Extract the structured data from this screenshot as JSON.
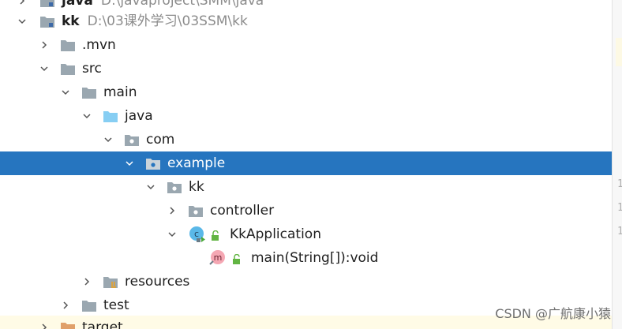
{
  "tree": {
    "top_partial": {
      "name": "java",
      "path": "D:\\javaproject\\SMM\\java"
    },
    "rows": [
      {
        "name": "kk",
        "path": "D:\\03课外学习\\03SSM\\kk"
      },
      {
        "name": ".mvn"
      },
      {
        "name": "src"
      },
      {
        "name": "main"
      },
      {
        "name": "java"
      },
      {
        "name": "com"
      },
      {
        "name": "example"
      },
      {
        "name": "kk"
      },
      {
        "name": "controller"
      },
      {
        "name": "KkApplication",
        "icon_letter": "c"
      },
      {
        "name": "main(String[]):void",
        "icon_letter": "m"
      },
      {
        "name": "resources"
      },
      {
        "name": "test"
      },
      {
        "name": "target"
      }
    ]
  },
  "colors": {
    "selection": "#2675bf",
    "folder_gray": "#9aa7b0",
    "source_folder": "#87cef3",
    "class_badge": "#5ab8e8",
    "method_badge": "#f5a7b3",
    "lock_green": "#62b543"
  },
  "gutter": {
    "numbers": [
      "1",
      "1",
      "1"
    ]
  },
  "watermark": "CSDN @广航康小猿"
}
